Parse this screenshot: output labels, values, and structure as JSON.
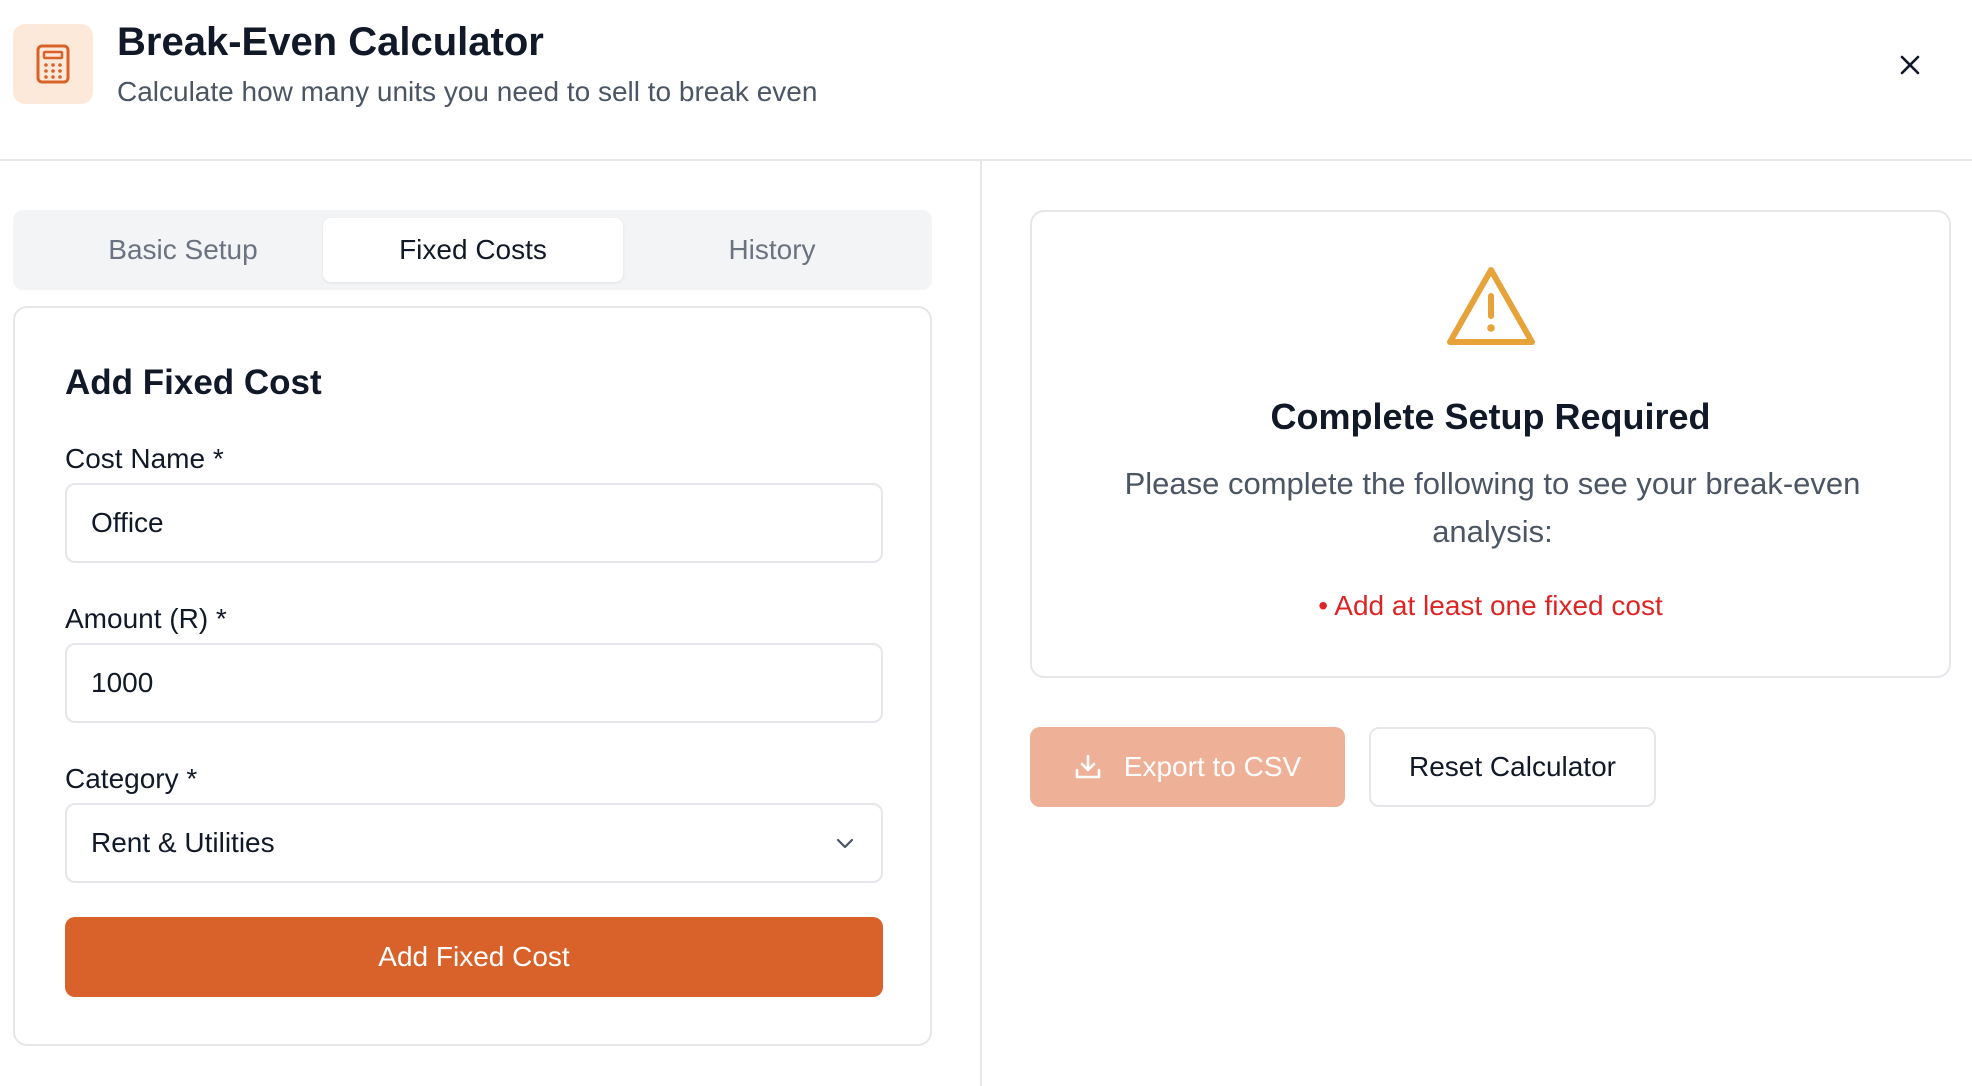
{
  "header": {
    "title": "Break-Even Calculator",
    "subtitle": "Calculate how many units you need to sell to break even",
    "icon": "calculator-icon",
    "close_icon": "close-icon"
  },
  "tabs": [
    {
      "label": "Basic Setup",
      "active": false
    },
    {
      "label": "Fixed Costs",
      "active": true
    },
    {
      "label": "History",
      "active": false
    }
  ],
  "form": {
    "title": "Add Fixed Cost",
    "cost_name_label": "Cost Name *",
    "cost_name_value": "Office",
    "amount_label": "Amount (R) *",
    "amount_value": "1000",
    "category_label": "Category *",
    "category_value": "Rent & Utilities",
    "submit_label": "Add Fixed Cost"
  },
  "alert": {
    "icon": "warning-icon",
    "title": "Complete Setup Required",
    "message": "Please complete the following to see your break-even analysis:",
    "requirement": "• Add at least one fixed cost"
  },
  "actions": {
    "export_label": "Export to CSV",
    "export_icon": "download-icon",
    "export_disabled": true,
    "reset_label": "Reset Calculator"
  },
  "colors": {
    "accent": "#d9622b",
    "accent_disabled": "#eeb096",
    "warning": "#e8a23a",
    "error": "#dc2626"
  }
}
